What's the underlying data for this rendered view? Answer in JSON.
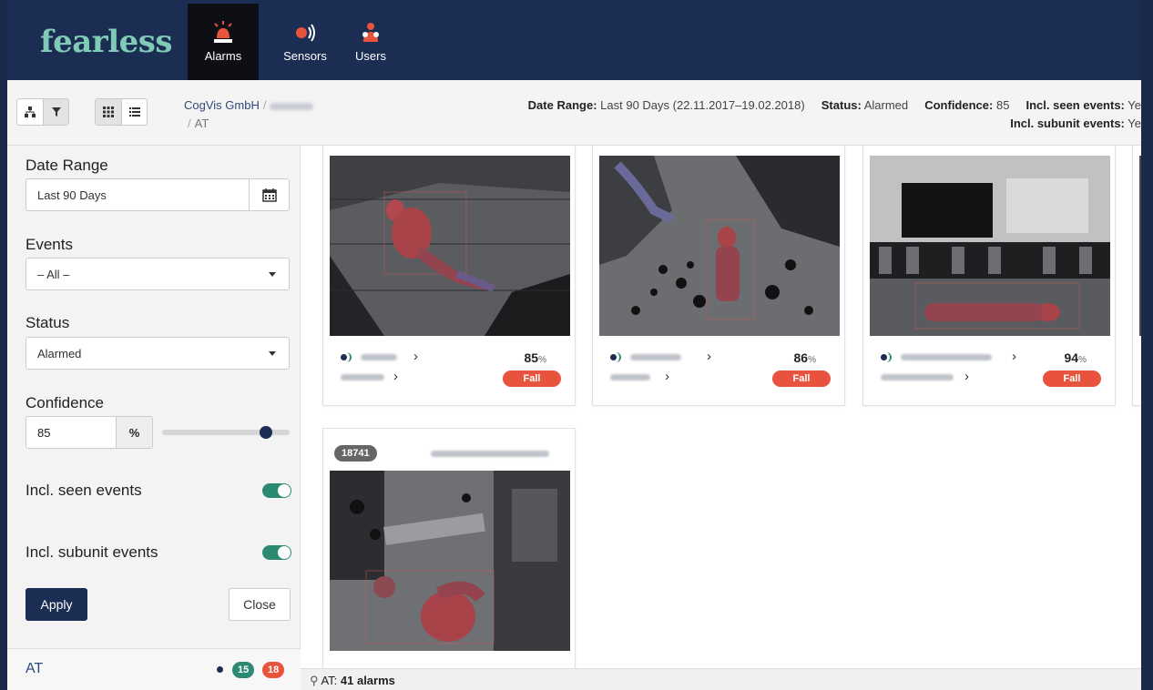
{
  "brand": "fearless",
  "nav": {
    "tabs": [
      {
        "label": "Alarms",
        "icon": "siren-icon",
        "active": true
      },
      {
        "label": "Sensors",
        "icon": "sensor-icon",
        "active": false
      },
      {
        "label": "Users",
        "icon": "users-icon",
        "active": false
      }
    ]
  },
  "toolbar": {
    "view_buttons": [
      "hierarchy-icon",
      "filter-icon",
      "grid-icon",
      "list-icon"
    ],
    "breadcrumb": {
      "org": "CogVis GmbH",
      "sub": "AT"
    },
    "summary": {
      "date_range_label": "Date Range:",
      "date_range_value": "Last 90 Days (22.11.2017–19.02.2018)",
      "status_label": "Status:",
      "status_value": "Alarmed",
      "confidence_label": "Confidence:",
      "confidence_value": "85",
      "seen_label": "Incl. seen events:",
      "seen_value": "Ye",
      "subunit_label": "Incl. subunit events:",
      "subunit_value": "Ye"
    }
  },
  "filters": {
    "date_range_label": "Date Range",
    "date_range_value": "Last 90 Days",
    "events_label": "Events",
    "events_value": "– All –",
    "status_label": "Status",
    "status_value": "Alarmed",
    "confidence_label": "Confidence",
    "confidence_value": "85",
    "confidence_unit": "%",
    "confidence_slider": 0.85,
    "seen_label": "Incl. seen events",
    "seen_on": true,
    "subunit_label": "Incl. subunit events",
    "subunit_on": true,
    "apply_label": "Apply",
    "close_label": "Close"
  },
  "unit": {
    "name": "AT",
    "count_green": "15",
    "count_red": "18"
  },
  "alarms": [
    {
      "confidence": "85",
      "unit": "%",
      "type": "Fall"
    },
    {
      "confidence": "86",
      "unit": "%",
      "type": "Fall"
    },
    {
      "confidence": "94",
      "unit": "%",
      "type": "Fall"
    },
    {
      "id": "18741"
    }
  ],
  "status": {
    "prefix": "AT:",
    "text": "41 alarms"
  },
  "colors": {
    "navy": "#1b2d52",
    "teal": "#2c8a73",
    "fall_red": "#e8533d",
    "brand_mint": "#7fcbb6"
  }
}
